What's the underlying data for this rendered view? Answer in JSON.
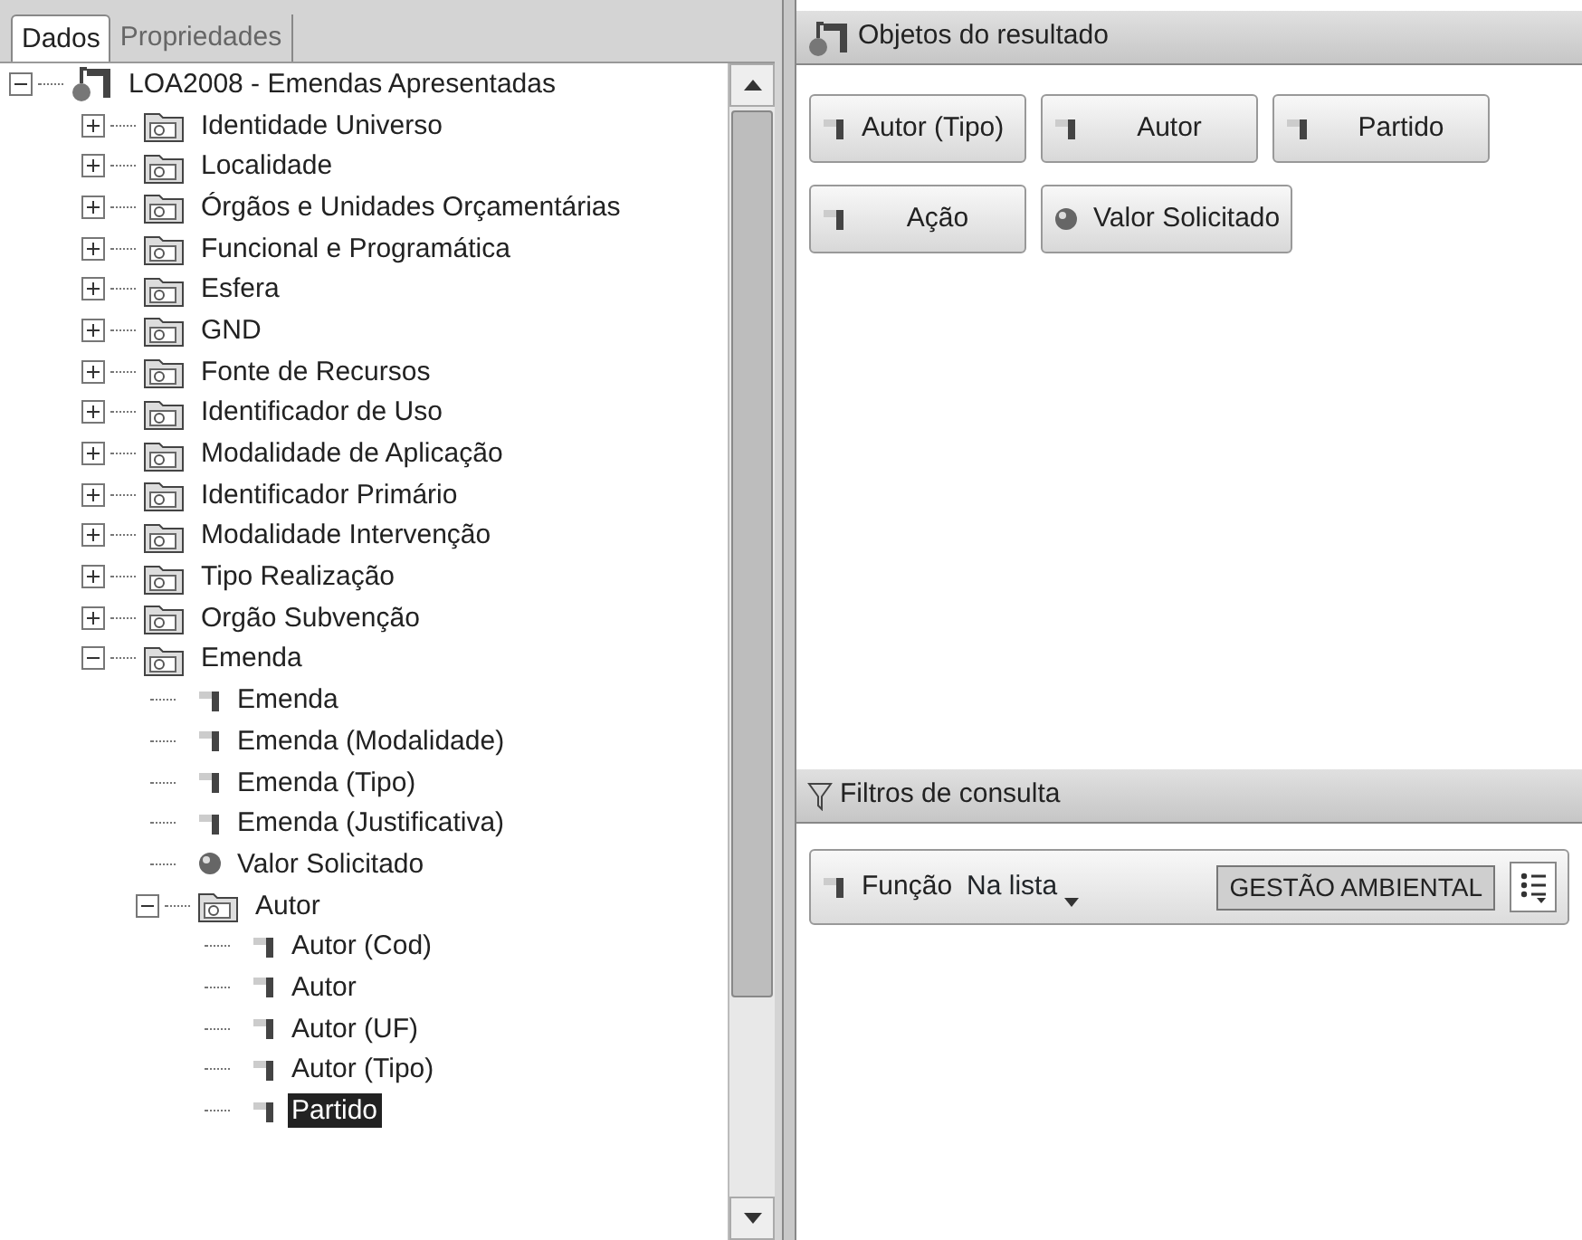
{
  "tabs": [
    {
      "label": "Dados",
      "selected": true
    },
    {
      "label": "Propriedades",
      "selected": false
    }
  ],
  "tree": [
    {
      "kind": "universe",
      "label": "LOA2008 - Emendas Apresentadas",
      "expanded": true,
      "selected": false,
      "children": [
        {
          "kind": "folder",
          "label": "Identidade Universo",
          "expanded": false,
          "selected": false
        },
        {
          "kind": "folder",
          "label": "Localidade",
          "expanded": false,
          "selected": false
        },
        {
          "kind": "folder",
          "label": "Órgãos e Unidades Orçamentárias",
          "expanded": false,
          "selected": false
        },
        {
          "kind": "folder",
          "label": "Funcional e Programática",
          "expanded": false,
          "selected": false
        },
        {
          "kind": "folder",
          "label": "Esfera",
          "expanded": false,
          "selected": false
        },
        {
          "kind": "folder",
          "label": "GND",
          "expanded": false,
          "selected": false
        },
        {
          "kind": "folder",
          "label": "Fonte de Recursos",
          "expanded": false,
          "selected": false
        },
        {
          "kind": "folder",
          "label": "Identificador de Uso",
          "expanded": false,
          "selected": false
        },
        {
          "kind": "folder",
          "label": "Modalidade de Aplicação",
          "expanded": false,
          "selected": false
        },
        {
          "kind": "folder",
          "label": "Identificador Primário",
          "expanded": false,
          "selected": false
        },
        {
          "kind": "folder",
          "label": "Modalidade Intervenção",
          "expanded": false,
          "selected": false
        },
        {
          "kind": "folder",
          "label": "Tipo Realização",
          "expanded": false,
          "selected": false
        },
        {
          "kind": "folder",
          "label": "Orgão Subvenção",
          "expanded": false,
          "selected": false
        },
        {
          "kind": "folder",
          "label": "Emenda",
          "expanded": true,
          "selected": false,
          "children": [
            {
              "kind": "dimension",
              "label": "Emenda",
              "selected": false
            },
            {
              "kind": "dimension",
              "label": "Emenda (Modalidade)",
              "selected": false
            },
            {
              "kind": "dimension",
              "label": "Emenda (Tipo)",
              "selected": false
            },
            {
              "kind": "dimension",
              "label": "Emenda (Justificativa)",
              "selected": false
            },
            {
              "kind": "measure",
              "label": "Valor Solicitado",
              "selected": false
            },
            {
              "kind": "folder",
              "label": "Autor",
              "expanded": true,
              "selected": false,
              "children": [
                {
                  "kind": "dimension",
                  "label": "Autor (Cod)",
                  "selected": false
                },
                {
                  "kind": "dimension",
                  "label": "Autor",
                  "selected": false
                },
                {
                  "kind": "dimension",
                  "label": "Autor (UF)",
                  "selected": false
                },
                {
                  "kind": "dimension",
                  "label": "Autor (Tipo)",
                  "selected": false
                },
                {
                  "kind": "dimension",
                  "label": "Partido",
                  "selected": true
                }
              ]
            }
          ]
        }
      ]
    }
  ],
  "result_objects": {
    "title": "Objetos do resultado",
    "items": [
      {
        "kind": "dimension",
        "label": "Autor (Tipo)"
      },
      {
        "kind": "dimension",
        "label": "Autor"
      },
      {
        "kind": "dimension",
        "label": "Partido"
      },
      {
        "kind": "dimension",
        "label": "Ação"
      },
      {
        "kind": "measure",
        "label": "Valor Solicitado"
      }
    ]
  },
  "query_filters": {
    "title": "Filtros de consulta",
    "filters": [
      {
        "kind": "dimension",
        "field": "Função",
        "operator": "Na lista",
        "value": "GESTÃO AMBIENTAL"
      }
    ]
  }
}
